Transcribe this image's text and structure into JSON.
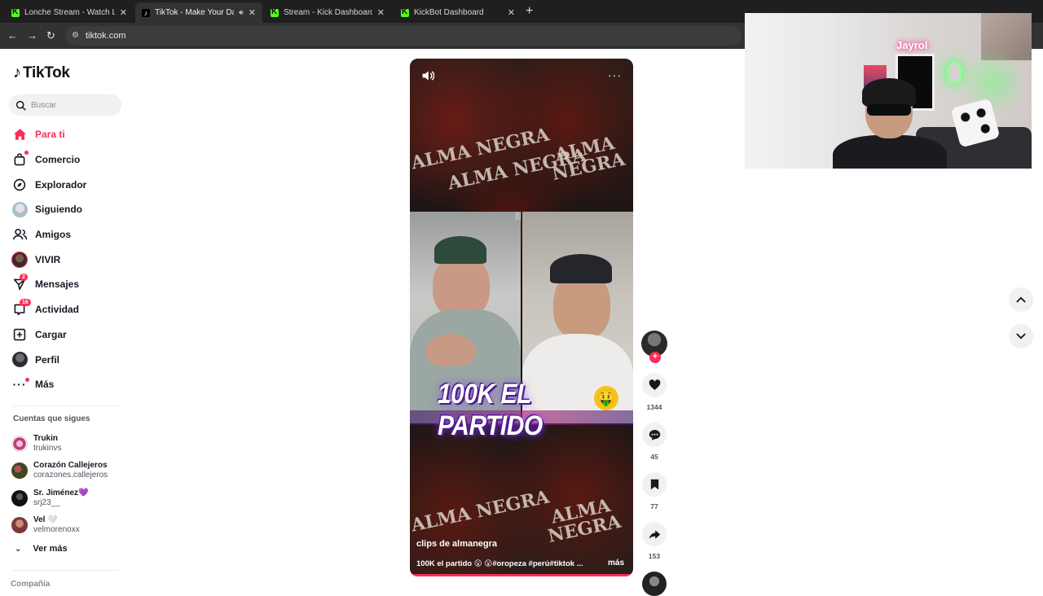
{
  "browser": {
    "tabs": [
      {
        "title": "Lonche Stream - Watch Live on",
        "favicon": "kick-icon",
        "active": false
      },
      {
        "title": "TikTok - Make Your Day",
        "favicon": "tiktok-icon",
        "active": true
      },
      {
        "title": "Stream - Kick Dashboard",
        "favicon": "kick-icon",
        "active": false
      },
      {
        "title": "KickBot Dashboard",
        "favicon": "kick-icon",
        "active": false
      }
    ],
    "url": "tiktok.com"
  },
  "sidebar": {
    "logo": "TikTok",
    "search_placeholder": "Buscar",
    "nav": [
      {
        "label": "Para ti",
        "icon": "home-icon",
        "active": true
      },
      {
        "label": "Comercio",
        "icon": "shop-icon"
      },
      {
        "label": "Explorador",
        "icon": "compass-icon"
      },
      {
        "label": "Siguiendo",
        "icon": "following-avatar-icon"
      },
      {
        "label": "Amigos",
        "icon": "friends-icon"
      },
      {
        "label": "VIVIR",
        "icon": "live-avatar-icon"
      },
      {
        "label": "Mensajes",
        "icon": "messages-icon",
        "badge": "2"
      },
      {
        "label": "Actividad",
        "icon": "activity-icon",
        "badge": "16"
      },
      {
        "label": "Cargar",
        "icon": "upload-icon"
      },
      {
        "label": "Perfil",
        "icon": "profile-avatar-icon"
      },
      {
        "label": "Más",
        "icon": "more-icon"
      }
    ],
    "following_title": "Cuentas que sigues",
    "following": [
      {
        "name": "Trukin",
        "handle": "trukinvs"
      },
      {
        "name": "Corazón Callejeros",
        "handle": "corazones.callejeros"
      },
      {
        "name": "Sr. Jiménez💜",
        "handle": "srj23__"
      },
      {
        "name": "Vel 🤍",
        "handle": "velmorenoxx"
      }
    ],
    "see_more": "Ver más",
    "company": "Compañía"
  },
  "video": {
    "overlay_text": "100K EL PARTIDO",
    "background_text": "ALMA NEGRA",
    "author": "clips de almanegra",
    "description": "100K el partido 😮 😮#oropeza #perú#tiktok ...",
    "more_label": "más",
    "progress": 1.0
  },
  "actions": {
    "likes": "1344",
    "comments": "45",
    "saves": "77",
    "shares": "153"
  },
  "webcam": {
    "neon_text": "Jayrol"
  },
  "colors": {
    "accent": "#fe2c55",
    "kick_green": "#53fc18",
    "chrome_dark": "#1f1f1f"
  }
}
